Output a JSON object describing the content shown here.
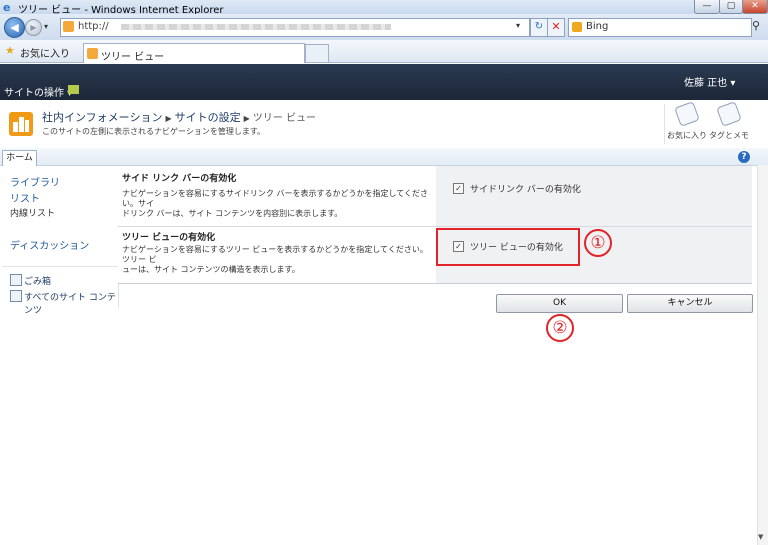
{
  "window": {
    "title": "ツリー ビュー - Windows Internet Explorer",
    "minimize": "—",
    "restore": "▢",
    "close": "✕"
  },
  "browser": {
    "address_text": "http://",
    "search_text": "Bing",
    "favorites_label": "お気に入り",
    "tab_title": "ツリー ビュー"
  },
  "sharepoint": {
    "site_actions": "サイトの操作 ▾",
    "user_name": "佐藤 正也 ▾",
    "breadcrumb": [
      "社内インフォメーション",
      "サイトの設定",
      "ツリー ビュー"
    ],
    "page_description": "このサイトの左側に表示されるナビゲーションを管理します。",
    "tools": [
      {
        "label": "お気に入り"
      },
      {
        "label": "タグとメモ"
      }
    ],
    "home_tab": "ホーム",
    "help": "?"
  },
  "quick_launch": {
    "library": "ライブラリ",
    "list": "リスト",
    "internal_list": "内線リスト",
    "discussion": "ディスカッション",
    "recycle_bin": "ごみ箱",
    "all_content": "すべてのサイト コンテンツ"
  },
  "settings": {
    "sidelink": {
      "title": "サイド リンク バーの有効化",
      "desc_line1": "ナビゲーションを容易にするサイドリンク バーを表示するかどうかを指定してください。サイ",
      "desc_line2": "ドリンク バーは、サイト コンテンツを内容別に表示します。",
      "checkbox_label": "サイドリンク バーの有効化",
      "checked": true
    },
    "treeview": {
      "title": "ツリー ビューの有効化",
      "desc_line1": "ナビゲーションを容易にするツリー ビューを表示するかどうかを指定してください。ツリー ビ",
      "desc_line2": "ューは、サイト コンテンツの構造を表示します。",
      "checkbox_label": "ツリー ビューの有効化",
      "checked": true
    }
  },
  "buttons": {
    "ok": "OK",
    "cancel": "キャンセル"
  },
  "annotations": {
    "marker1": "①",
    "marker2": "②",
    "highlight_color": "#e0242a"
  },
  "colors": {
    "ribbon_dark": "#1c2738",
    "link_blue": "#1f5a9c",
    "site_icon": "#f09a17"
  }
}
